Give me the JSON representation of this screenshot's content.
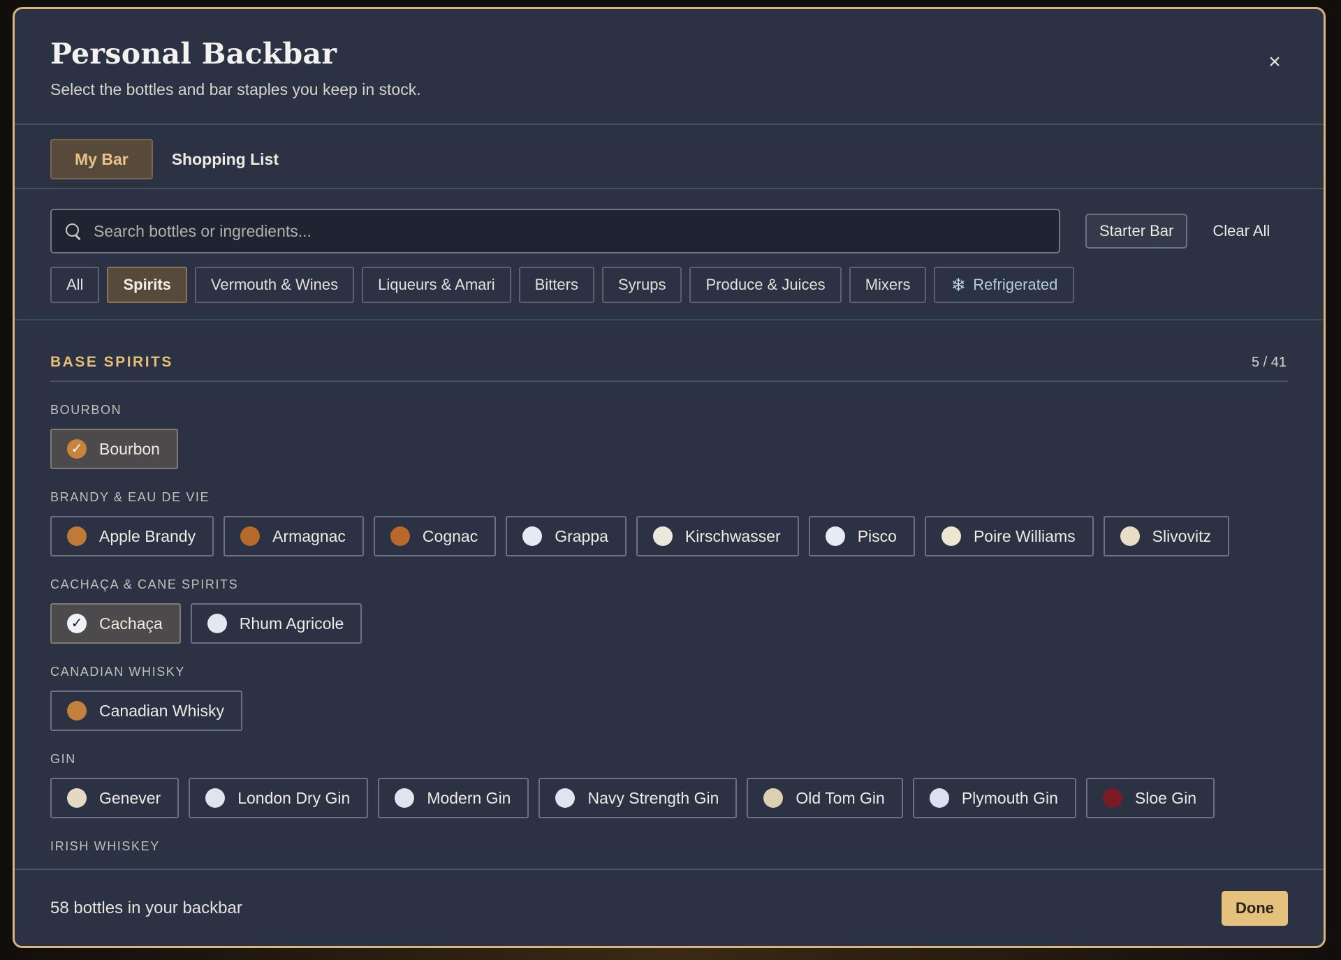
{
  "modal": {
    "title": "Personal Backbar",
    "subtitle": "Select the bottles and bar staples you keep in stock.",
    "close_icon": "close-icon"
  },
  "tabs": [
    {
      "label": "My Bar",
      "active": true
    },
    {
      "label": "Shopping List",
      "active": false
    }
  ],
  "search": {
    "placeholder": "Search bottles or ingredients...",
    "value": ""
  },
  "actions": {
    "starter_bar": "Starter Bar",
    "clear_all": "Clear All"
  },
  "filters": [
    {
      "label": "All",
      "active": false
    },
    {
      "label": "Spirits",
      "active": true
    },
    {
      "label": "Vermouth & Wines",
      "active": false
    },
    {
      "label": "Liqueurs & Amari",
      "active": false
    },
    {
      "label": "Bitters",
      "active": false
    },
    {
      "label": "Syrups",
      "active": false
    },
    {
      "label": "Produce & Juices",
      "active": false
    },
    {
      "label": "Mixers",
      "active": false
    },
    {
      "label": "Refrigerated",
      "active": false,
      "icon": "snowflake-icon"
    }
  ],
  "section": {
    "title": "BASE SPIRITS",
    "count": "5 / 41"
  },
  "groups": [
    {
      "label": "BOURBON",
      "items": [
        {
          "label": "Bourbon",
          "color": "#c8843a",
          "selected": true
        }
      ]
    },
    {
      "label": "BRANDY & EAU DE VIE",
      "items": [
        {
          "label": "Apple Brandy",
          "color": "#c07a36",
          "selected": false
        },
        {
          "label": "Armagnac",
          "color": "#b56a2c",
          "selected": false
        },
        {
          "label": "Cognac",
          "color": "#b8682a",
          "selected": false
        },
        {
          "label": "Grappa",
          "color": "#e4ebf2",
          "selected": false
        },
        {
          "label": "Kirschwasser",
          "color": "#ece8de",
          "selected": false
        },
        {
          "label": "Pisco",
          "color": "#e6ecf4",
          "selected": false
        },
        {
          "label": "Poire Williams",
          "color": "#efe6d0",
          "selected": false
        },
        {
          "label": "Slivovitz",
          "color": "#e8ddc6",
          "selected": false
        }
      ]
    },
    {
      "label": "CACHAÇA & CANE SPIRITS",
      "items": [
        {
          "label": "Cachaça",
          "color": "#eef1f5",
          "selected": true
        },
        {
          "label": "Rhum Agricole",
          "color": "#e2e8f0",
          "selected": false
        }
      ]
    },
    {
      "label": "CANADIAN WHISKY",
      "items": [
        {
          "label": "Canadian Whisky",
          "color": "#c4813c",
          "selected": false
        }
      ]
    },
    {
      "label": "GIN",
      "items": [
        {
          "label": "Genever",
          "color": "#e4dac4",
          "selected": false
        },
        {
          "label": "London Dry Gin",
          "color": "#dde5ef",
          "selected": false
        },
        {
          "label": "Modern Gin",
          "color": "#dde5ef",
          "selected": false
        },
        {
          "label": "Navy Strength Gin",
          "color": "#dde5ef",
          "selected": false
        },
        {
          "label": "Old Tom Gin",
          "color": "#ddd1b4",
          "selected": false
        },
        {
          "label": "Plymouth Gin",
          "color": "#d9e2ee",
          "selected": false
        },
        {
          "label": "Sloe Gin",
          "color": "#7a1a24",
          "selected": false
        }
      ]
    },
    {
      "label": "IRISH WHISKEY",
      "items": []
    }
  ],
  "footer": {
    "status": "58 bottles in your backbar",
    "done": "Done"
  }
}
